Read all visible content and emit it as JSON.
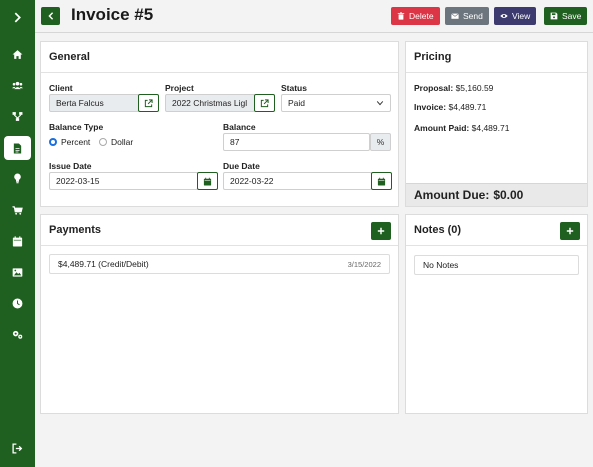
{
  "header": {
    "title": "Invoice #5",
    "buttons": {
      "delete": "Delete",
      "send": "Send",
      "view": "View",
      "save": "Save"
    }
  },
  "sidebar": {
    "items": [
      {
        "name": "chevron-right-icon"
      },
      {
        "name": "home-icon"
      },
      {
        "name": "users-icon"
      },
      {
        "name": "network-icon"
      },
      {
        "name": "document-icon",
        "active": true
      },
      {
        "name": "lightbulb-icon"
      },
      {
        "name": "cart-icon"
      },
      {
        "name": "calendar-icon"
      },
      {
        "name": "image-icon"
      },
      {
        "name": "clock-icon"
      },
      {
        "name": "gears-icon"
      },
      {
        "name": "logout-icon"
      }
    ]
  },
  "general": {
    "title": "General",
    "client_label": "Client",
    "client_value": "Berta Falcus",
    "project_label": "Project",
    "project_value": "2022 Christmas Ligl",
    "status_label": "Status",
    "status_value": "Paid",
    "balance_type_label": "Balance Type",
    "balance_type_options": [
      "Percent",
      "Dollar"
    ],
    "balance_type_selected": "Percent",
    "balance_label": "Balance",
    "balance_value": "87",
    "balance_unit": "%",
    "issue_date_label": "Issue Date",
    "issue_date_value": "2022-03-15",
    "due_date_label": "Due Date",
    "due_date_value": "2022-03-22"
  },
  "pricing": {
    "title": "Pricing",
    "proposal_label": "Proposal:",
    "proposal_value": "$5,160.59",
    "invoice_label": "Invoice:",
    "invoice_value": "$4,489.71",
    "amount_paid_label": "Amount Paid:",
    "amount_paid_value": "$4,489.71",
    "amount_due_label": "Amount Due:",
    "amount_due_value": "$0.00"
  },
  "payments": {
    "title": "Payments",
    "items": [
      {
        "amount": "$4,489.71 (Credit/Debit)",
        "date": "3/15/2022"
      }
    ]
  },
  "notes": {
    "title": "Notes (0)",
    "empty_text": "No Notes"
  },
  "colors": {
    "brand_green": "#1f5f1f",
    "delete_red": "#dc3545",
    "send_grey": "#6c757d",
    "view_purple": "#3c3a6e",
    "radio_blue": "#1a6ee0"
  }
}
